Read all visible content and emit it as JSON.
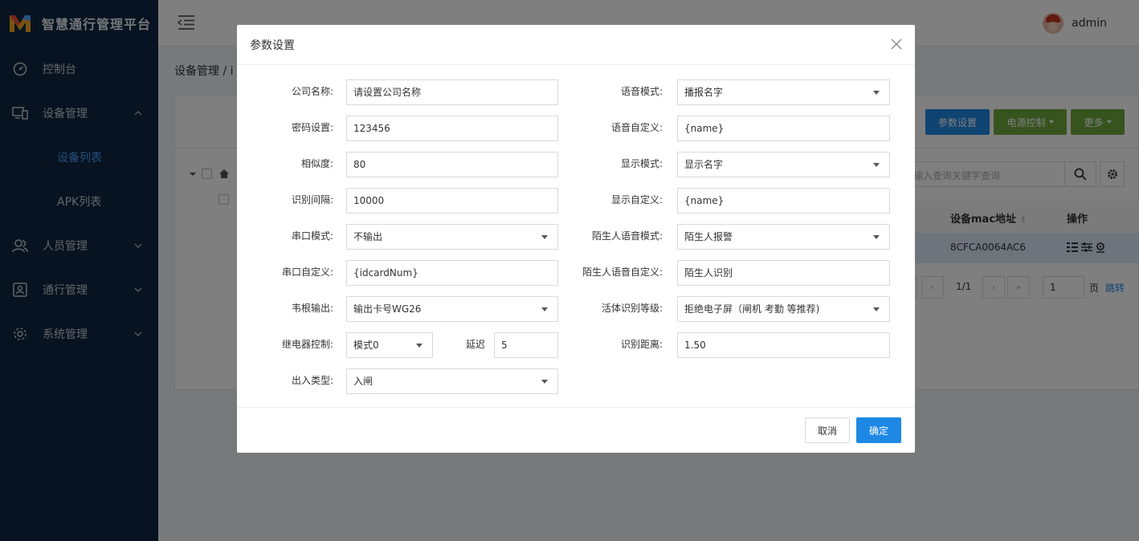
{
  "app": {
    "title": "智慧通行管理平台",
    "user": "admin"
  },
  "sidebar": {
    "items": [
      {
        "label": "控制台",
        "icon": "dashboard-icon"
      },
      {
        "label": "设备管理",
        "icon": "devices-icon",
        "expanded": true
      },
      {
        "label": "人员管理",
        "icon": "users-icon"
      },
      {
        "label": "通行管理",
        "icon": "access-icon"
      },
      {
        "label": "系统管理",
        "icon": "settings-icon"
      }
    ],
    "sub": [
      {
        "label": "设备列表",
        "active": true
      },
      {
        "label": "APK列表"
      }
    ]
  },
  "breadcrumb": "设备管理  /  i",
  "toolbar": {
    "params": "参数设置",
    "power": "电源控制",
    "more": "更多"
  },
  "search": {
    "placeholder": "输入查询关键字查询"
  },
  "table": {
    "headers": [
      "设备mac地址",
      "操作"
    ],
    "rows": [
      {
        "mac": "8CFCA0064AC6"
      }
    ]
  },
  "pager": {
    "prev": "‹",
    "next": "›",
    "last": "»",
    "info": "1/1",
    "page": "1",
    "page_suffix": "页",
    "jump": "跳转"
  },
  "modal": {
    "title": "参数设置",
    "left": [
      {
        "label": "公司名称:",
        "value": "请设置公司名称",
        "type": "input"
      },
      {
        "label": "密码设置:",
        "value": "123456",
        "type": "input"
      },
      {
        "label": "相似度:",
        "value": "80",
        "type": "input"
      },
      {
        "label": "识别间隔:",
        "value": "10000",
        "type": "input"
      },
      {
        "label": "串口模式:",
        "value": "不输出",
        "type": "select"
      },
      {
        "label": "串口自定义:",
        "value": "{idcardNum}",
        "type": "input"
      },
      {
        "label": "韦根输出:",
        "value": "输出卡号WG26",
        "type": "select"
      }
    ],
    "relay": {
      "label": "继电器控制:",
      "value": "模式0",
      "delay_label": "延迟",
      "delay_value": "5"
    },
    "io": {
      "label": "出入类型:",
      "value": "入闸"
    },
    "right": [
      {
        "label": "语音模式:",
        "value": "播报名字",
        "type": "select"
      },
      {
        "label": "语音自定义:",
        "value": "{name}",
        "type": "input"
      },
      {
        "label": "显示模式:",
        "value": "显示名字",
        "type": "select"
      },
      {
        "label": "显示自定义:",
        "value": "{name}",
        "type": "input"
      },
      {
        "label": "陌生人语音模式:",
        "value": "陌生人报警",
        "type": "select"
      },
      {
        "label": "陌生人语音自定义:",
        "value": "陌生人识别",
        "type": "input"
      },
      {
        "label": "活体识别等级:",
        "value": "拒绝电子屏（闸机 考勤 等推荐)",
        "type": "select"
      },
      {
        "label": "识别距离:",
        "value": "1.50",
        "type": "input"
      }
    ],
    "cancel": "取消",
    "ok": "确定"
  },
  "colors": {
    "sidebar": "#0f2741",
    "primary": "#1e88e5",
    "green": "#6fa83c",
    "active_link": "#4ba3ff"
  }
}
